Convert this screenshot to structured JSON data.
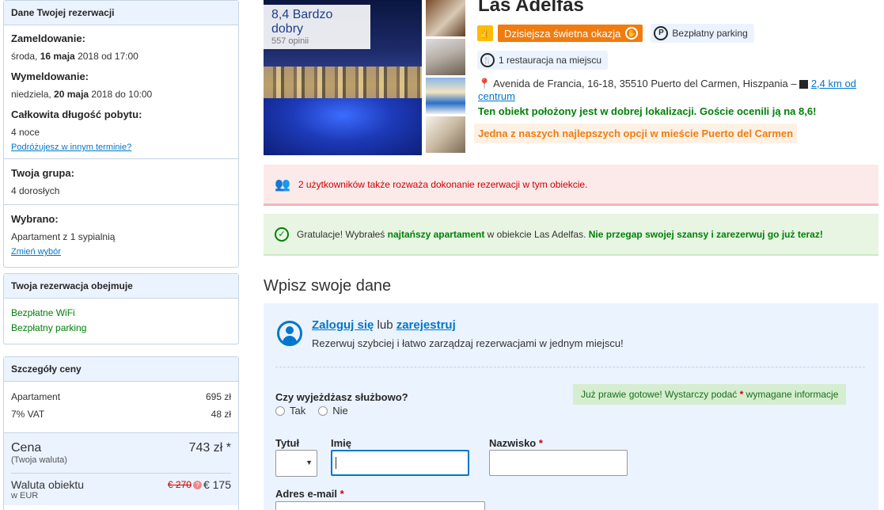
{
  "sidebar": {
    "reservation": {
      "header": "Dane Twojej rezerwacji",
      "checkin_label": "Zameldowanie:",
      "checkin_day": "środa, ",
      "checkin_date": "16 maja",
      "checkin_rest": " 2018 od 17:00",
      "checkout_label": "Wymeldowanie:",
      "checkout_day": "niedziela, ",
      "checkout_date": "20 maja",
      "checkout_rest": " 2018 do 10:00",
      "stay_label": "Całkowita długość pobytu:",
      "stay_value": "4 noce",
      "other_dates_link": "Podróżujesz w innym terminie?",
      "group_label": "Twoja grupa:",
      "group_value": "4 dorosłych",
      "selected_label": "Wybrano:",
      "selected_value": "Apartament z 1 sypialnią",
      "change_link": "Zmień wybór"
    },
    "includes": {
      "header": "Twoja rezerwacja obejmuje",
      "items": [
        "Bezpłatne WiFi",
        "Bezpłatny parking"
      ]
    },
    "price": {
      "header": "Szczegóły ceny",
      "rows": [
        {
          "label": "Apartament",
          "value": "695 zł"
        },
        {
          "label": "7% VAT",
          "value": "48 zł"
        }
      ],
      "total_label": "Cena",
      "total_sub": "(Twoja waluta)",
      "total_value": "743 zł *",
      "prop_label": "Waluta obiektu",
      "prop_sub": "w EUR",
      "prop_old": "€ 270",
      "prop_new": "€ 175"
    }
  },
  "hotel": {
    "score_text": "8,4 Bardzo dobry",
    "reviews": "557 opinii",
    "name": "Las Adelfas",
    "deal_label": "Dzisiejsza świetna okazja",
    "parking_label": "Bezpłatny parking",
    "restaurant_label": "1 restauracja na miejscu",
    "address": "Avenida de Francia, 16-18, 35510 Puerto del Carmen, Hiszpania – ",
    "distance": "2,4 km od centrum",
    "location_note": "Ten obiekt położony jest w dobrej lokalizacji. Goście ocenili ją na 8,6!",
    "best_option": "Jedna z naszych najlepszych opcji w mieście Puerto del Carmen"
  },
  "alerts": {
    "users_text": "2 użytkowników także rozważa dokonanie rezerwacji w tym obiekcie.",
    "congrats_a": "Gratulacje! Wybrałeś ",
    "congrats_b": "najtańszy apartament",
    "congrats_c": " w obiekcie Las Adelfas. ",
    "congrats_d": "Nie przegap swojej szansy i zarezerwuj go już teraz!"
  },
  "form": {
    "title": "Wpisz swoje dane",
    "login": "Zaloguj się",
    "or": " lub ",
    "register": "zarejestruj",
    "login_sub": "Rezerwuj szybciej i łatwo zarządzaj rezerwacjami w jednym miejscu!",
    "almost_a": "Już prawie gotowe! Wystarczy podać ",
    "almost_star": "*",
    "almost_b": " wymagane informacje",
    "business_q": "Czy wyjeżdżasz służbowo?",
    "yes": "Tak",
    "no": "Nie",
    "title_label": "Tytuł",
    "first_name_label": "Imię",
    "last_name_label": "Nazwisko",
    "req_star": "*",
    "email_label": "Adres e-mail"
  }
}
